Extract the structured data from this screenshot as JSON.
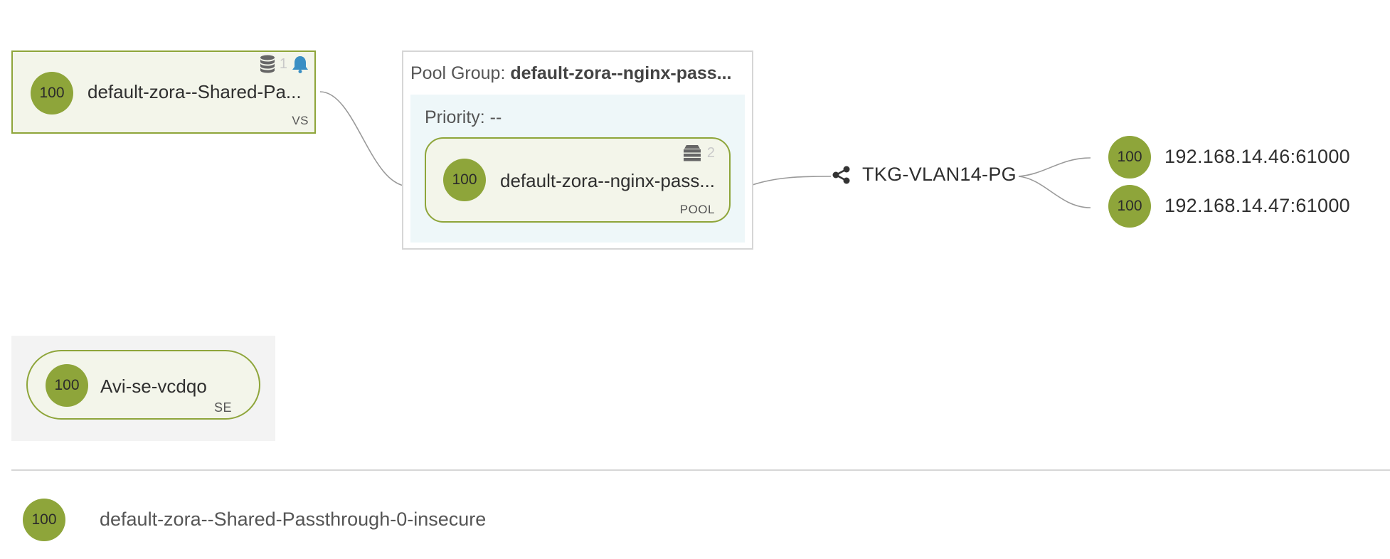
{
  "virtual_service": {
    "health": "100",
    "name": "default-zora--Shared-Pa...",
    "type_label": "VS",
    "alert_count": "1"
  },
  "pool_group": {
    "title_prefix": "Pool Group:",
    "title_name": "default-zora--nginx-pass...",
    "priority_label": "Priority: --",
    "pool": {
      "health": "100",
      "name": "default-zora--nginx-pass...",
      "type_label": "POOL",
      "server_count": "2"
    }
  },
  "network": {
    "label": "TKG-VLAN14-PG"
  },
  "servers": [
    {
      "health": "100",
      "address": "192.168.14.46:61000"
    },
    {
      "health": "100",
      "address": "192.168.14.47:61000"
    }
  ],
  "service_engine": {
    "health": "100",
    "name": "Avi-se-vcdqo",
    "type_label": "SE"
  },
  "footer": {
    "health": "100",
    "name": "default-zora--Shared-Passthrough-0-insecure"
  },
  "colors": {
    "health_green": "#8ea53a",
    "alert_blue": "#3a8fc4"
  }
}
